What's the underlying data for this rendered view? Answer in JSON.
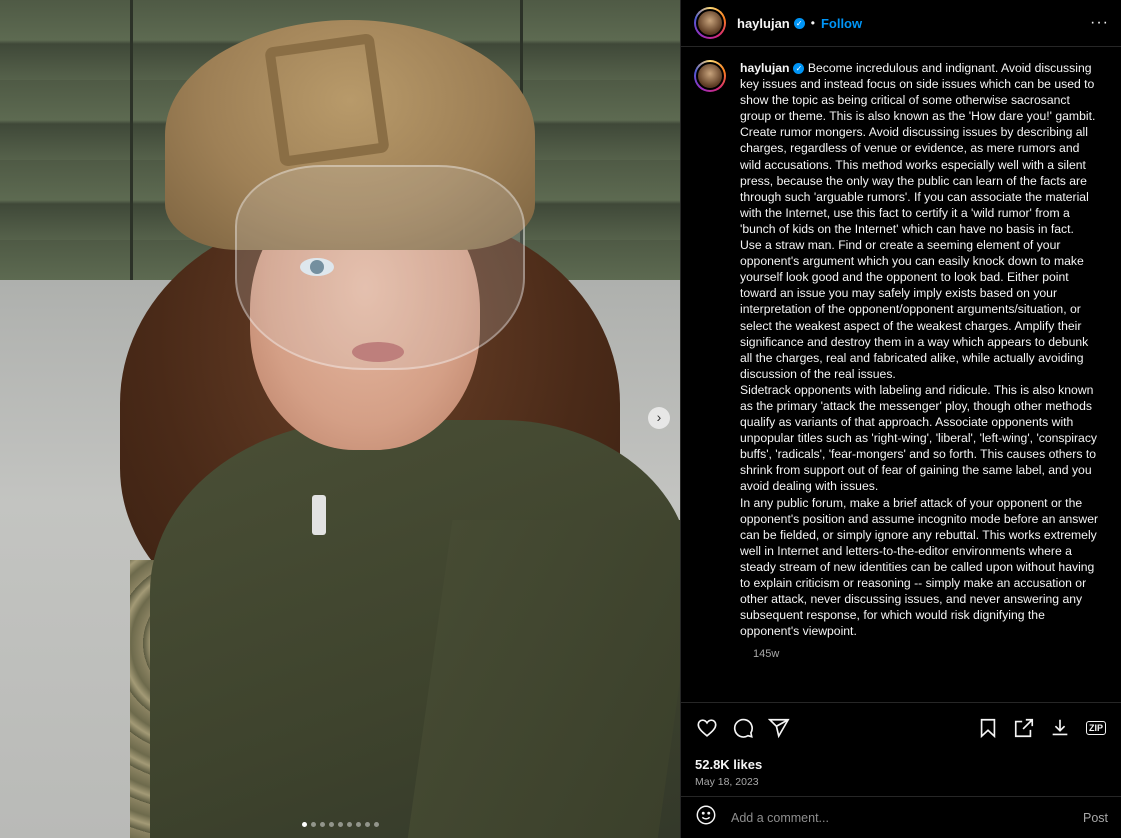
{
  "post": {
    "username": "haylujan",
    "follow_label": "Follow",
    "separator": "•",
    "more_label": "···",
    "verified_mark": "✓"
  },
  "caption": {
    "username": "haylujan",
    "paragraphs": [
      "Become incredulous and indignant. Avoid discussing key issues and instead focus on side issues which can be used to show the topic as being critical of some otherwise sacrosanct group or theme. This is also known as the 'How dare you!' gambit.",
      "Create rumor mongers. Avoid discussing issues by describing all charges, regardless of venue or evidence, as mere rumors and wild accusations. This method works especially well with a silent press, because the only way the public can learn of the facts are through such 'arguable rumors'. If you can associate the material with the Internet, use this fact to certify it a 'wild rumor' from a 'bunch of kids on the Internet' which can have no basis in fact.",
      "Use a straw man. Find or create a seeming element of your opponent's argument which you can easily knock down to make yourself look good and the opponent to look bad. Either point toward an issue you may safely imply exists based on your interpretation of the opponent/opponent arguments/situation, or select the weakest aspect of the weakest charges. Amplify their significance and destroy them in a way which appears to debunk all the charges, real and fabricated alike, while actually avoiding discussion of the real issues.",
      "Sidetrack opponents with labeling and ridicule. This is also known as the primary 'attack the messenger' ploy, though other methods qualify as variants of that approach. Associate opponents with unpopular titles such as 'right-wing', 'liberal', 'left-wing', 'conspiracy buffs', 'radicals', 'fear-mongers' and so forth. This causes others to shrink from support out of fear of gaining the same label, and you avoid dealing with issues.",
      "In any public forum, make a brief attack of your opponent or the opponent's position and assume incognito mode before an answer can be fielded, or simply ignore any rebuttal. This works extremely well in Internet and letters-to-the-editor environments where a steady stream of new identities can be called upon without having to explain criticism or reasoning -- simply make an accusation or other attack, never discussing issues, and never answering any subsequent response, for which would risk dignifying the opponent's viewpoint."
    ],
    "age": "145w"
  },
  "engagement": {
    "likes": "52.8K likes",
    "date": "May 18, 2023",
    "zip_label": "ZIP"
  },
  "comment": {
    "placeholder": "Add a comment...",
    "post_label": "Post"
  },
  "media": {
    "next_label": "›",
    "dot_count": 9,
    "active_dot": 0
  },
  "colors": {
    "accent": "#0095f6",
    "background": "#000000",
    "border": "#262626",
    "muted_text": "#a8a8a8"
  }
}
